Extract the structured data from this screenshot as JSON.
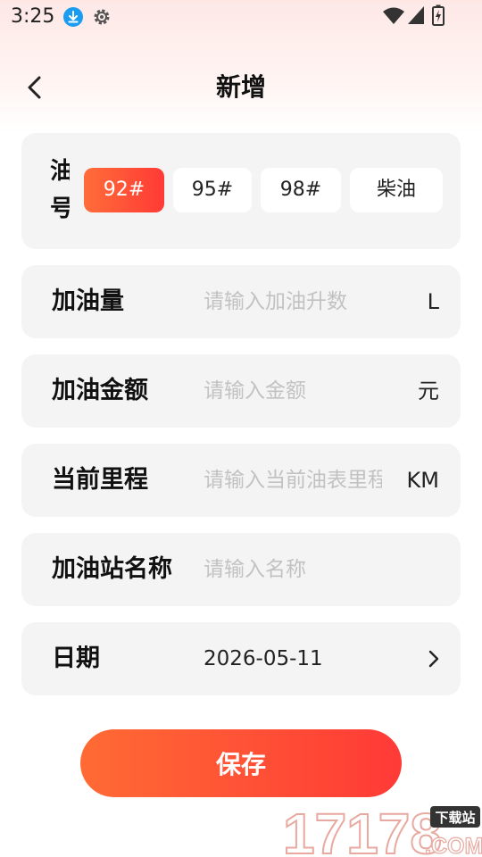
{
  "status_bar": {
    "time": "3:25",
    "icons": [
      "download-icon",
      "gear-icon",
      "wifi-icon",
      "signal-icon",
      "battery-charging-icon"
    ]
  },
  "header": {
    "title": "新增",
    "back_icon": "chevron-left-icon"
  },
  "fuel_type": {
    "label": "油号",
    "options": [
      "92#",
      "95#",
      "98#",
      "柴油"
    ],
    "selected": "92#"
  },
  "fields": {
    "volume": {
      "label": "加油量",
      "placeholder": "请输入加油升数",
      "value": "",
      "unit": "L"
    },
    "amount": {
      "label": "加油金额",
      "placeholder": "请输入金额",
      "value": "",
      "unit": "元"
    },
    "mileage": {
      "label": "当前里程",
      "placeholder": "请输入当前油表里程",
      "value": "",
      "unit": "KM"
    },
    "station": {
      "label": "加油站名称",
      "placeholder": "请输入名称",
      "value": ""
    },
    "date": {
      "label": "日期",
      "value": "2026-05-11",
      "icon": "chevron-right-icon"
    }
  },
  "save_button": {
    "label": "保存"
  },
  "watermark": {
    "number": "17178",
    "badge": "下载站",
    "suffix": ".COM"
  },
  "colors": {
    "accent_start": "#ff6b34",
    "accent_end": "#ff3a37",
    "card_bg": "#f4f4f4",
    "placeholder": "#c2c2c2"
  }
}
